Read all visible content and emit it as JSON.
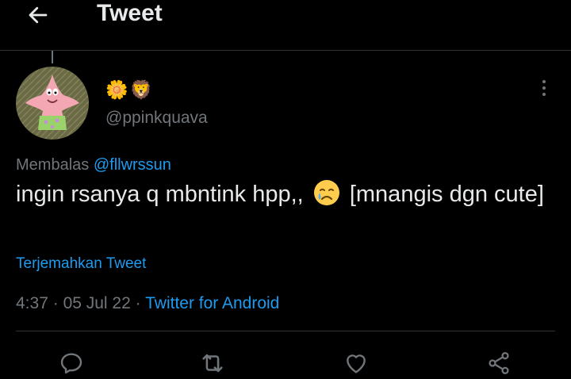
{
  "header": {
    "title": "Tweet",
    "back_icon": "arrow-left-icon"
  },
  "tweet": {
    "display_name_emojis": [
      "🌼",
      "🦁"
    ],
    "handle": "@ppinkquava",
    "replying_prefix": "Membalas",
    "replying_to": "@fllwrssun",
    "text_before_emoji": "ingin rsanya q mbntink hpp,,",
    "emoji": "crying-face-emoji",
    "text_after_emoji": "[mnangis dgn cute]",
    "translate_label": "Terjemahkan Tweet",
    "time": "4:37",
    "date": "05 Jul 22",
    "separator": "·",
    "source": "Twitter for Android"
  },
  "actions": [
    {
      "name": "reply",
      "icon": "reply-icon"
    },
    {
      "name": "retweet",
      "icon": "retweet-icon"
    },
    {
      "name": "like",
      "icon": "heart-icon"
    },
    {
      "name": "share",
      "icon": "share-icon"
    }
  ],
  "colors": {
    "background": "#000000",
    "text": "#e7e9ea",
    "secondary": "#71767b",
    "accent": "#1d9bf0",
    "border": "#2f3336"
  }
}
